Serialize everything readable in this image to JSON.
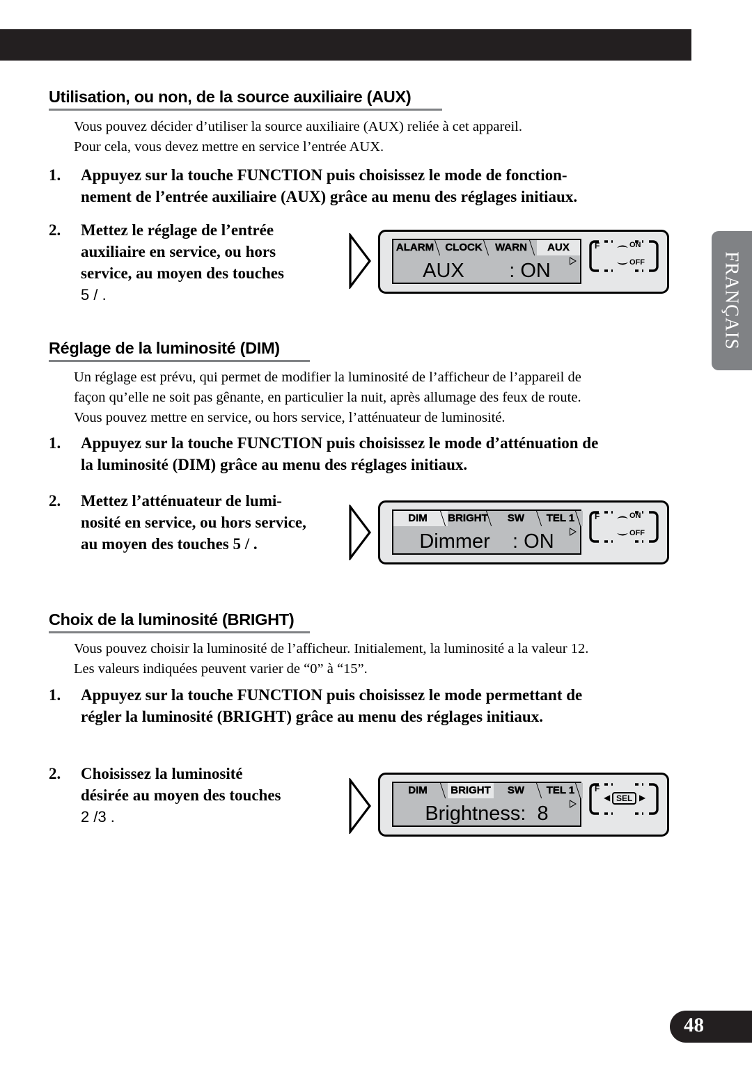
{
  "page": {
    "number": "48",
    "language_tab": "FRANÇAIS"
  },
  "sections": [
    {
      "heading": "Utilisation, ou non, de la source auxiliaire (AUX)",
      "intro": [
        "Vous pouvez décider d’utiliser la source auxiliaire (AUX) reliée à cet appareil.",
        "Pour cela, vous devez mettre en service l’entrée AUX."
      ],
      "steps": [
        {
          "num": "1.",
          "lines": [
            "Appuyez sur la touche FUNCTION puis choisissez le mode de fonction-",
            "nement de l’entrée auxiliaire (AUX) grâce au menu des réglages initiaux."
          ]
        },
        {
          "num": "2.",
          "lines": [
            "Mettez le réglage de l’entrée",
            "auxiliaire en service, ou hors",
            "service, au moyen des touches",
            "5 /  ."
          ]
        }
      ],
      "display": {
        "tabs": [
          {
            "label": "ALARM",
            "selected": false
          },
          {
            "label": "CLOCK",
            "selected": false
          },
          {
            "label": "WARN",
            "selected": false
          },
          {
            "label": "AUX",
            "selected": true
          }
        ],
        "readout": "AUX        : ON",
        "control": {
          "type": "on-off",
          "f_label": "F",
          "on_label": "ON",
          "off_label": "OFF"
        }
      }
    },
    {
      "heading": "Réglage de la luminosité (DIM)",
      "intro": [
        "Un réglage est prévu, qui permet de modifier la luminosité de l’afficheur de l’appareil de",
        "façon qu’elle ne soit pas gênante, en particulier la nuit, après allumage des feux de route.",
        "Vous pouvez mettre en service, ou hors service, l’atténuateur de luminosité."
      ],
      "steps": [
        {
          "num": "1.",
          "lines": [
            "Appuyez sur la touche FUNCTION puis choisissez le mode d’atténuation de",
            "la luminosité (DIM) grâce au menu des réglages initiaux."
          ]
        },
        {
          "num": "2.",
          "lines": [
            "Mettez l’atténuateur de lumi-",
            "nosité en service, ou hors service,",
            "au moyen des touches 5 /  ."
          ]
        }
      ],
      "display": {
        "tabs": [
          {
            "label": "DIM",
            "selected": true
          },
          {
            "label": "BRIGHT",
            "selected": false
          },
          {
            "label": "SW",
            "selected": false
          },
          {
            "label": "TEL 1",
            "selected": false
          }
        ],
        "readout": "Dimmer    : ON",
        "control": {
          "type": "on-off",
          "f_label": "F",
          "on_label": "ON",
          "off_label": "OFF"
        }
      }
    },
    {
      "heading": "Choix de la luminosité (BRIGHT)",
      "intro": [
        "Vous pouvez choisir la luminosité de l’afficheur. Initialement, la luminosité a la valeur 12.",
        "Les valeurs indiquées peuvent varier de “0” à “15”."
      ],
      "steps": [
        {
          "num": "1.",
          "lines": [
            "Appuyez sur la touche FUNCTION puis choisissez le mode permettant de",
            "régler la luminosité (BRIGHT) grâce au menu des réglages initiaux."
          ]
        },
        {
          "num": "2.",
          "lines": [
            "Choisissez la luminosité",
            "désirée au moyen des touches",
            "2 /3 ."
          ]
        }
      ],
      "display": {
        "tabs": [
          {
            "label": "DIM",
            "selected": false
          },
          {
            "label": "BRIGHT",
            "selected": true
          },
          {
            "label": "SW",
            "selected": false
          },
          {
            "label": "TEL 1",
            "selected": false
          }
        ],
        "readout": "Brightness:  8",
        "control": {
          "type": "sel",
          "f_label": "F",
          "left_arrow": "◀",
          "sel_label": "SEL",
          "right_arrow": "▶"
        }
      }
    }
  ],
  "colors": {
    "bar": "#231f20",
    "lang_tab": "#808285",
    "screen": "#bcbec0",
    "bezel": "#e6e7e8"
  }
}
